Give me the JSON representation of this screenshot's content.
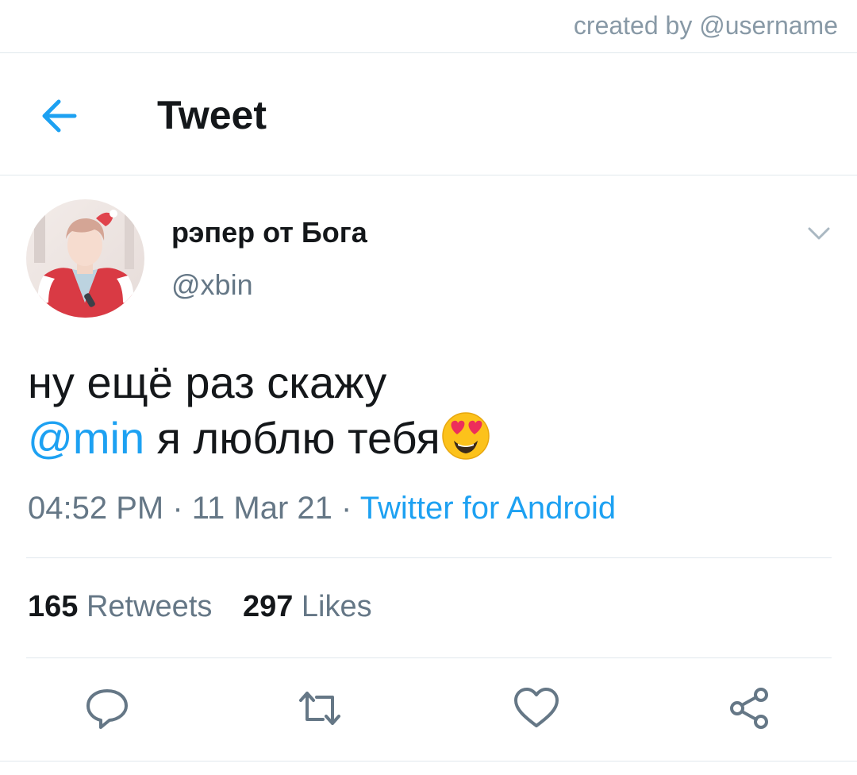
{
  "watermark": "created by @username",
  "header": {
    "title": "Tweet",
    "back_icon": "arrow-left-icon"
  },
  "tweet": {
    "author": {
      "display_name": "рэпер от Бога",
      "handle": "@xbin"
    },
    "text_line1": "ну ещё раз скажу",
    "mention": "@min",
    "text_line2_rest": " я люблю тебя",
    "emoji": "heart-eyes-emoji",
    "time": "04:52 PM",
    "sep1": " · ",
    "date": "11 Mar 21",
    "sep2": " · ",
    "source": "Twitter for Android",
    "retweets_count": "165",
    "retweets_label": "Retweets",
    "likes_count": "297",
    "likes_label": "Likes"
  },
  "actions": [
    "reply-icon",
    "retweet-icon",
    "like-icon",
    "share-icon"
  ],
  "colors": {
    "accent": "#1da1f2",
    "text": "#14171a",
    "secondary": "#657786",
    "divider": "#e1e8ed"
  }
}
